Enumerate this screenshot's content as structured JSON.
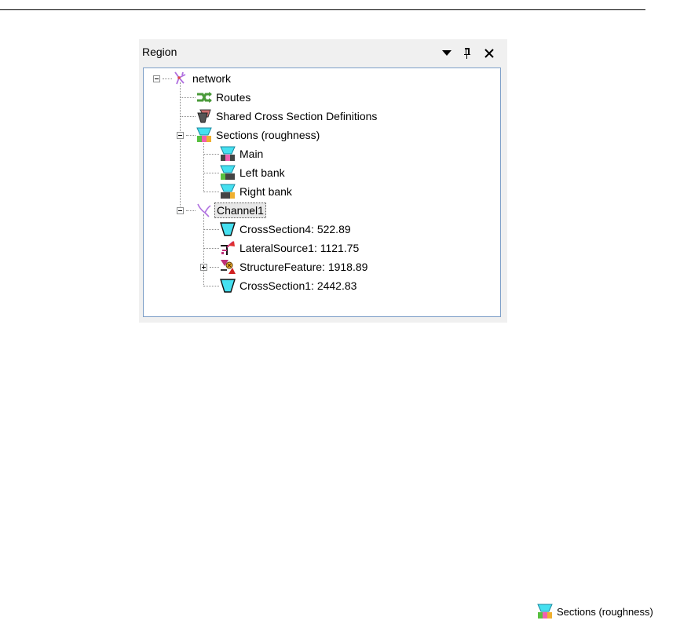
{
  "panel": {
    "title": "Region",
    "buttons": [
      {
        "name": "dropdown",
        "icon": "triangle-down-icon",
        "glyph": "▼"
      },
      {
        "name": "pin",
        "icon": "pin-icon",
        "glyph": "ᵖ"
      },
      {
        "name": "close",
        "icon": "close-icon",
        "glyph": "✕"
      }
    ]
  },
  "tree": {
    "network": {
      "label": "network",
      "icon": "network-icon",
      "expanded": true
    },
    "routes": {
      "label": "Routes",
      "icon": "routes-icon"
    },
    "shared_cs": {
      "label": "Shared Cross Section Definitions",
      "icon": "shared-cross-section-icon"
    },
    "sections": {
      "label": "Sections (roughness)",
      "icon": "sections-roughness-icon",
      "expanded": true
    },
    "main": {
      "label": "Main",
      "icon": "section-main-icon"
    },
    "left_bank": {
      "label": "Left bank",
      "icon": "section-left-bank-icon"
    },
    "right_bank": {
      "label": "Right bank",
      "icon": "section-right-bank-icon"
    },
    "channel1": {
      "label": "Channel1",
      "icon": "channel-icon",
      "expanded": true,
      "selected": true
    },
    "cs4": {
      "label": "CrossSection4: 522.89",
      "icon": "cross-section-icon"
    },
    "lateral1": {
      "label": "LateralSource1: 1121.75",
      "icon": "lateral-source-icon"
    },
    "structure": {
      "label": "StructureFeature: 1918.89",
      "icon": "structure-feature-icon",
      "expanded": false
    },
    "cs1": {
      "label": "CrossSection1: 2442.83",
      "icon": "cross-section-icon"
    }
  },
  "legend": {
    "label": "Sections (roughness)",
    "icon": "sections-roughness-icon"
  },
  "colors": {
    "tree_border": "#7d9fc8",
    "panel_bg": "#f0f0f0",
    "section_cyan": "#45e0f0",
    "network_purple": "#b070e0",
    "routes_green": "#4a9a3a"
  }
}
